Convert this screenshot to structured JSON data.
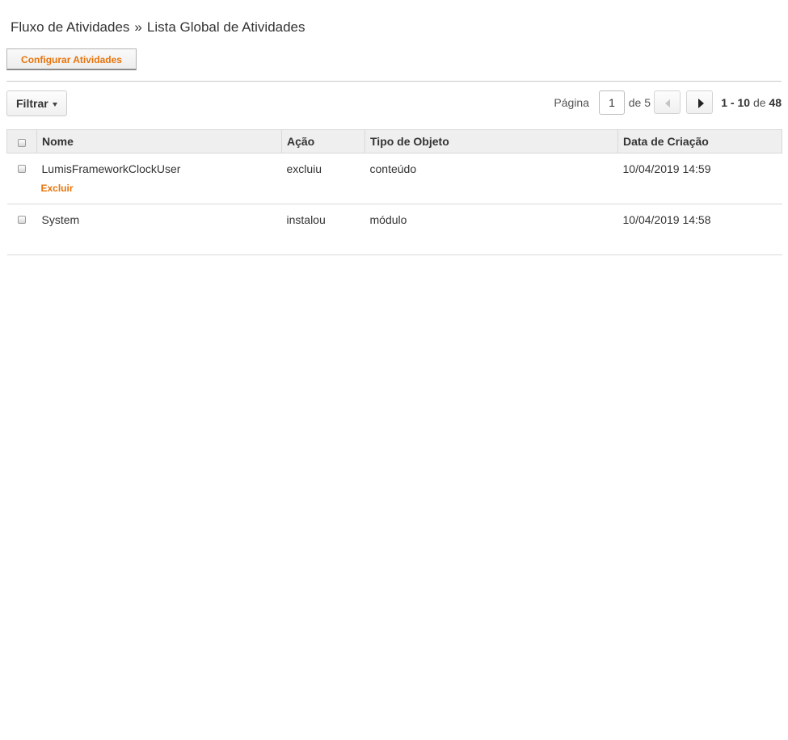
{
  "breadcrumb": {
    "parent": "Fluxo de Atividades",
    "separator": "»",
    "current": "Lista Global de Atividades"
  },
  "toolbar": {
    "configure_label": "Configurar Atividades"
  },
  "filter": {
    "label": "Filtrar"
  },
  "pagination": {
    "page_label": "Página",
    "current_page": "1",
    "of_label": "de 5",
    "range_start": "1",
    "range_dash": "-",
    "range_end": "10",
    "range_of": "de",
    "total": "48"
  },
  "table": {
    "columns": [
      "Nome",
      "Ação",
      "Tipo de Objeto",
      "Data de Criação"
    ],
    "rows": [
      {
        "nome": "LumisFrameworkClockUser",
        "acao": "excluiu",
        "tipo": "conteúdo",
        "data": "10/04/2019 14:59",
        "action_label": "Excluir"
      },
      {
        "nome": "System",
        "acao": "instalou",
        "tipo": "módulo",
        "data": "10/04/2019 14:58"
      }
    ]
  },
  "colors": {
    "accent": "#e8740c",
    "header_bg": "#efefef",
    "border": "#d9d9d9"
  }
}
